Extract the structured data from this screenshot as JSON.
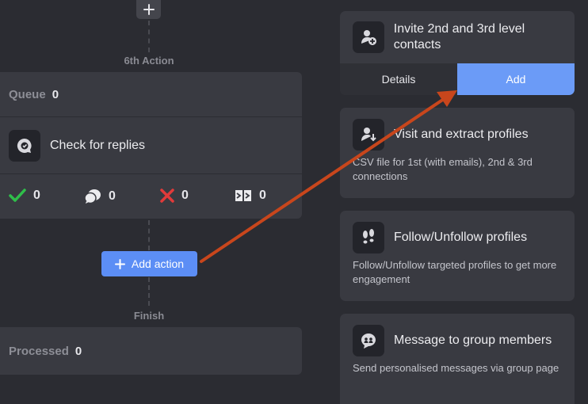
{
  "flow": {
    "step_label": "6th Action",
    "queue": {
      "label": "Queue",
      "count": "0"
    },
    "action": {
      "title": "Check for replies",
      "icon": "reply-check-icon"
    },
    "stats": [
      {
        "icon": "checkmark-icon",
        "value": "0",
        "color": "#2fbf4a"
      },
      {
        "icon": "replies-icon",
        "value": "0",
        "color": "#ececef"
      },
      {
        "icon": "cross-icon",
        "value": "0",
        "color": "#e23a3a"
      },
      {
        "icon": "skipped-icon",
        "value": "0",
        "color": "#ececef"
      }
    ],
    "add_action_label": "Add action",
    "finish_label": "Finish",
    "processed": {
      "label": "Processed",
      "count": "0"
    }
  },
  "panels": [
    {
      "title": "Invite 2nd and 3rd level contacts",
      "icon": "invite-contact-icon",
      "tabs": {
        "details": "Details",
        "add": "Add"
      }
    },
    {
      "title": "Visit and extract profiles",
      "icon": "download-profile-icon",
      "description": "CSV file for 1st (with emails), 2nd & 3rd connections"
    },
    {
      "title": "Follow/Unfollow profiles",
      "icon": "footsteps-icon",
      "description": "Follow/Unfollow targeted profiles to get more engagement"
    },
    {
      "title": "Message to group members",
      "icon": "group-message-icon",
      "description": "Send personalised messages via group page"
    }
  ],
  "colors": {
    "accent": "#5c8ef5",
    "arrow": "#c8461c",
    "background": "#2b2c32",
    "card": "#393a41"
  }
}
